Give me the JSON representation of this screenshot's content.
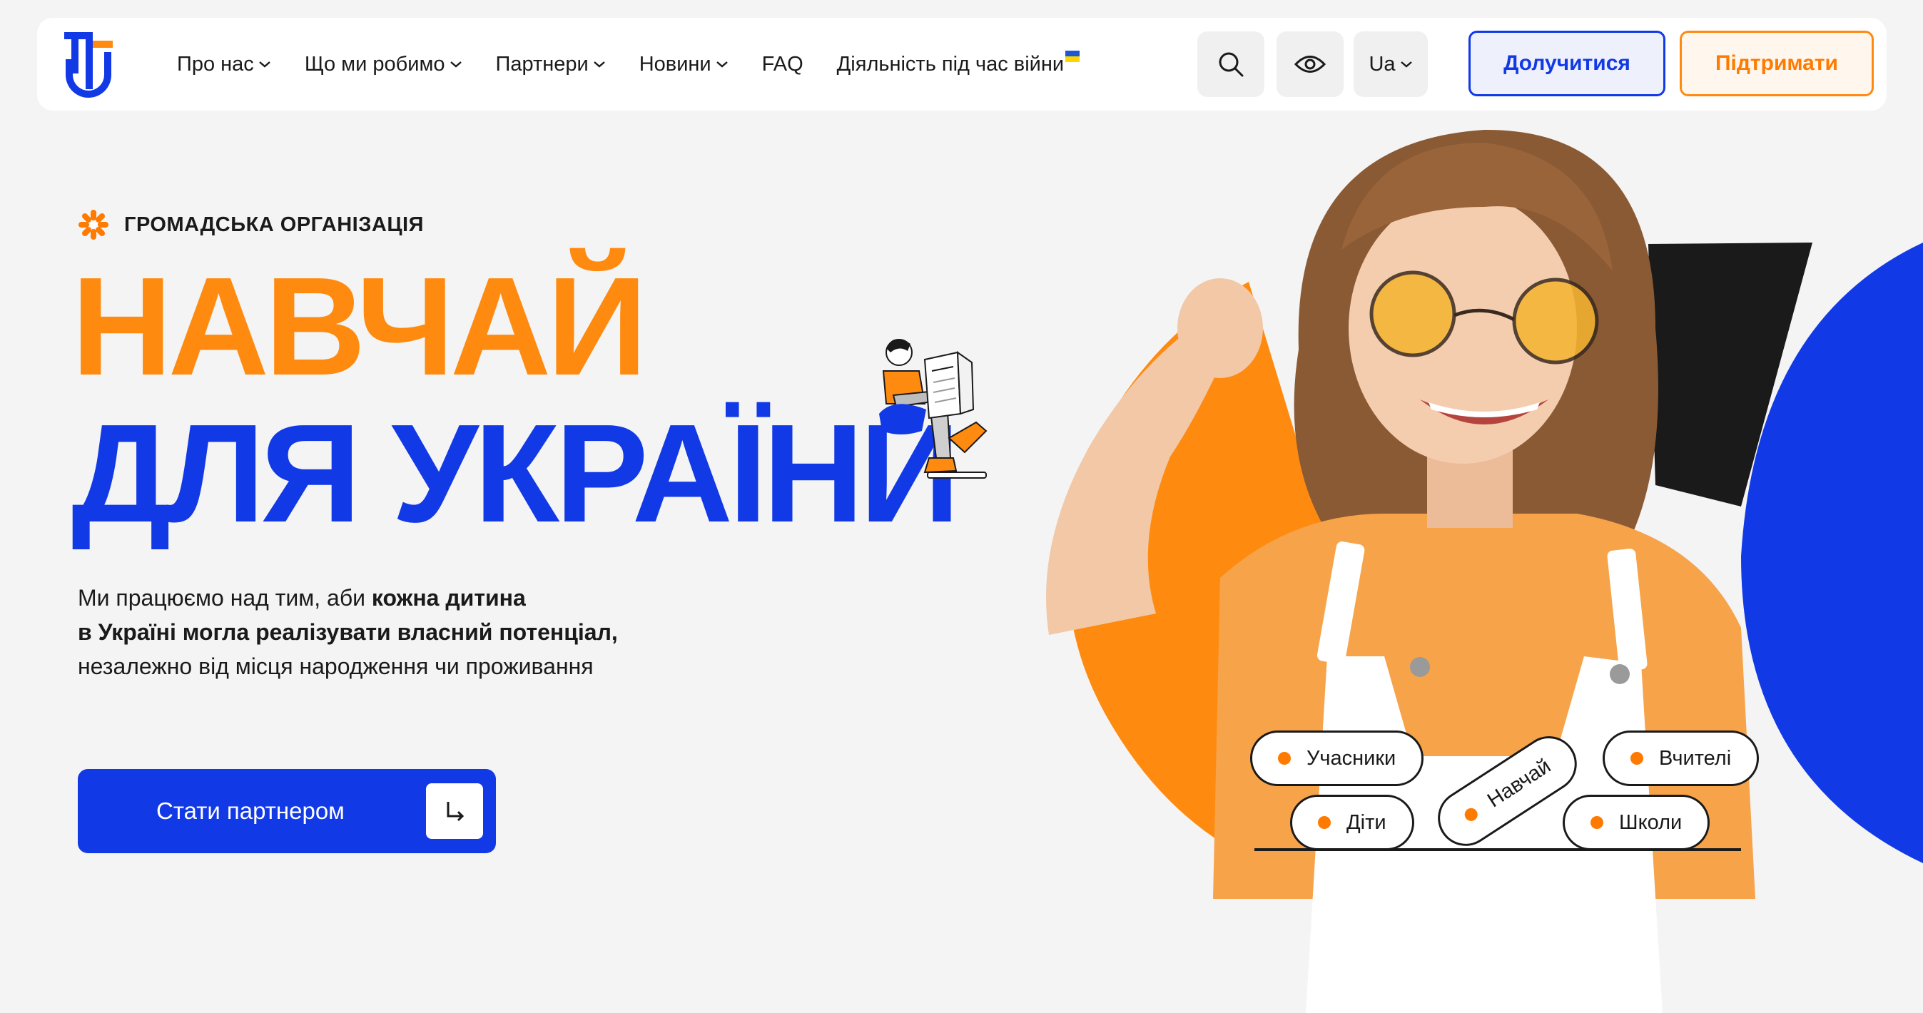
{
  "header": {
    "nav": [
      {
        "label": "Про нас",
        "has_dropdown": true
      },
      {
        "label": "Що ми робимо",
        "has_dropdown": true
      },
      {
        "label": "Партнери",
        "has_dropdown": true
      },
      {
        "label": "Новини",
        "has_dropdown": true
      },
      {
        "label": "FAQ",
        "has_dropdown": false
      },
      {
        "label": "Діяльність під час війни",
        "has_dropdown": false
      }
    ],
    "icons": {
      "search": "search-icon",
      "accessibility": "eye-icon",
      "flag": "ukraine-flag-icon"
    },
    "language": "Ua",
    "join_label": "Долучитися",
    "support_label": "Підтримати"
  },
  "hero": {
    "badge": "ГРОМАДСЬКА ОРГАНІЗАЦІЯ",
    "title_line1": "НАВЧАЙ",
    "title_line2": "ДЛЯ УКРАЇНИ",
    "description": {
      "part1": "Ми працюємо над тим, аби ",
      "bold1": "кожна дитина",
      "bold2": "в Україні могла реалізувати власний потенціал,",
      "part2": "незалежно від місця народження чи проживання"
    },
    "cta_label": "Стати партнером",
    "tags": [
      "Учасники",
      "Вчителі",
      "Діти",
      "Школи",
      "Навчай"
    ]
  },
  "colors": {
    "brand_blue": "#1239e6",
    "brand_orange": "#ff8a10",
    "dark": "#1a1a1a",
    "background": "#f4f4f4"
  }
}
